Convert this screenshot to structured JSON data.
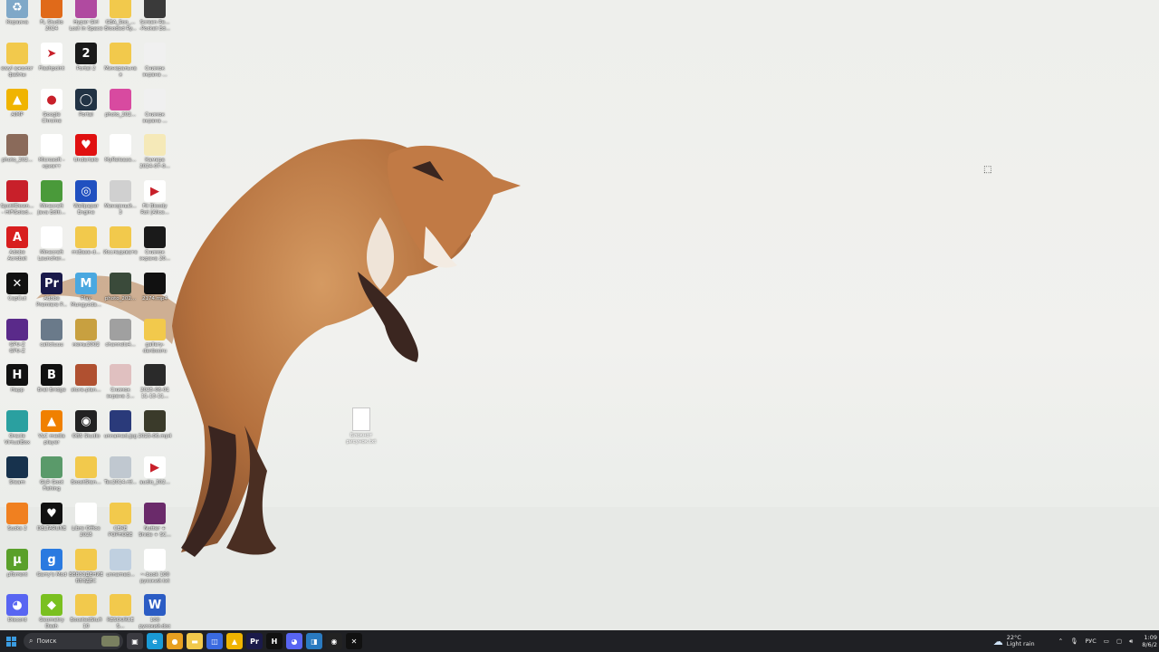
{
  "desktop": {
    "icons": [
      {
        "label": "Корзина",
        "icon": "recycle-bin-icon",
        "color": "#7fa8c8",
        "glyph": "♻"
      },
      {
        "label": "FL Studio\n2024",
        "icon": "fl-studio-icon",
        "color": "#e06a1a",
        "glyph": ""
      },
      {
        "label": "Hyper Girl\nLost In Space",
        "icon": "game-icon",
        "color": "#b04aa0",
        "glyph": ""
      },
      {
        "label": "GBA_Soo_...\nBlooded Ry...",
        "icon": "folder-icon",
        "color": "#f2c94c",
        "glyph": ""
      },
      {
        "label": "Screen Re...\n-Pocket Ed...",
        "icon": "video-file-icon",
        "color": "#3a3a3a",
        "glyph": ""
      },
      {
        "label": "ewyl ажолог\nфайлы",
        "icon": "folder-icon",
        "color": "#f2c94c",
        "glyph": ""
      },
      {
        "label": "Flashpoint",
        "icon": "flashpoint-icon",
        "color": "#ffffff",
        "glyph": "➤"
      },
      {
        "label": "Portal 2",
        "icon": "portal2-icon",
        "color": "#1a1a1a",
        "glyph": "2"
      },
      {
        "label": "Минеральная",
        "icon": "folder-icon",
        "color": "#f2c94c",
        "glyph": ""
      },
      {
        "label": "Снимок\nэкрана ...",
        "icon": "screenshot-file-icon",
        "color": "#f0f0f0",
        "glyph": ""
      },
      {
        "label": "AIMP",
        "icon": "aimp-icon",
        "color": "#f0b400",
        "glyph": "▲"
      },
      {
        "label": "Google\nChrome",
        "icon": "chrome-icon",
        "color": "#ffffff",
        "glyph": "●"
      },
      {
        "label": "Portal",
        "icon": "portal-icon",
        "color": "#223344",
        "glyph": "◯"
      },
      {
        "label": "photo_202...",
        "icon": "image-file-icon",
        "color": "#d84aa0",
        "glyph": ""
      },
      {
        "label": "Снимок\nэкрана ...",
        "icon": "screenshot-file-icon",
        "color": "#f0f0f0",
        "glyph": ""
      },
      {
        "label": "photo_202...",
        "icon": "image-file-icon",
        "color": "#8a6a5a",
        "glyph": ""
      },
      {
        "label": "Microsoft -\nкриатт",
        "icon": "blank-file-icon",
        "color": "#ffffff",
        "glyph": ""
      },
      {
        "label": "Undertale",
        "icon": "undertale-icon",
        "color": "#e01010",
        "glyph": "♥"
      },
      {
        "label": "MyRelease...",
        "icon": "blank-file-icon",
        "color": "#ffffff",
        "glyph": ""
      },
      {
        "label": "Камера\n2024-07-0...",
        "icon": "image-file-icon",
        "color": "#f5e9b8",
        "glyph": ""
      },
      {
        "label": "SpotifDown...\n- HiFiSoled...",
        "icon": "app-icon",
        "color": "#c8202a",
        "glyph": ""
      },
      {
        "label": "Minecraft\nJava Editi...",
        "icon": "minecraft-icon",
        "color": "#4a9a3a",
        "glyph": ""
      },
      {
        "label": "Wallpaper\nEngine",
        "icon": "wallpaper-engine-icon",
        "color": "#2050c0",
        "glyph": "◎"
      },
      {
        "label": "Минорный...\n3",
        "icon": "image-file-icon",
        "color": "#d0d0d0",
        "glyph": ""
      },
      {
        "label": "Fit Bloody\nRot [Alice...",
        "icon": "media-file-icon",
        "color": "#ffffff",
        "glyph": "▶"
      },
      {
        "label": "Adobe\nAcrobat",
        "icon": "acrobat-icon",
        "color": "#d81e1e",
        "glyph": "A"
      },
      {
        "label": "Minecraft\nLauncher...",
        "icon": "blank-file-icon",
        "color": "#ffffff",
        "glyph": ""
      },
      {
        "label": "rrcBase-d...",
        "icon": "folder-icon",
        "color": "#f2c94c",
        "glyph": ""
      },
      {
        "label": "Исследовате",
        "icon": "folder-icon",
        "color": "#f2c94c",
        "glyph": ""
      },
      {
        "label": "Снимок\nэкрана 20...",
        "icon": "screenshot-file-icon",
        "color": "#1a1a1a",
        "glyph": ""
      },
      {
        "label": "CapCut",
        "icon": "capcut-icon",
        "color": "#111111",
        "glyph": "✕"
      },
      {
        "label": "Adobe\nPremiere P...",
        "icon": "premiere-icon",
        "color": "#1a1a4a",
        "glyph": "Pr"
      },
      {
        "label": "Play\nMungyoda...",
        "icon": "play-icon",
        "color": "#4aa8e0",
        "glyph": "M"
      },
      {
        "label": "photo_202...",
        "icon": "image-file-icon",
        "color": "#3a4a3a",
        "glyph": ""
      },
      {
        "label": "2174.mp4",
        "icon": "video-file-icon",
        "color": "#111111",
        "glyph": ""
      },
      {
        "label": "GPU-Z\nGPU-Z",
        "icon": "gpuz-icon",
        "color": "#5a2a8a",
        "glyph": ""
      },
      {
        "label": "catictuuu",
        "icon": "app-icon",
        "color": "#6a7a8a",
        "glyph": ""
      },
      {
        "label": "мемы2002",
        "icon": "folder-icon",
        "color": "#c8a040",
        "glyph": ""
      },
      {
        "label": "channels4...",
        "icon": "image-file-icon",
        "color": "#a0a0a0",
        "glyph": ""
      },
      {
        "label": "gallery-\ndanbooru",
        "icon": "folder-icon",
        "color": "#f2c94c",
        "glyph": ""
      },
      {
        "label": "Happ",
        "icon": "happ-icon",
        "color": "#111111",
        "glyph": "H"
      },
      {
        "label": "Brat Bridge",
        "icon": "app-icon",
        "color": "#111111",
        "glyph": "B"
      },
      {
        "label": "store-plan...",
        "icon": "image-file-icon",
        "color": "#b05030",
        "glyph": ""
      },
      {
        "label": "Снимок\nэкрана 2...",
        "icon": "screenshot-file-icon",
        "color": "#e0c0c0",
        "glyph": ""
      },
      {
        "label": "2025-06-01\n11-13-11...",
        "icon": "video-file-icon",
        "color": "#2a2a2a",
        "glyph": ""
      },
      {
        "label": "Oracle\nVirtualBox",
        "icon": "virtualbox-icon",
        "color": "#2aa0a0",
        "glyph": ""
      },
      {
        "label": "VLC media\nplayer",
        "icon": "vlc-icon",
        "color": "#f08000",
        "glyph": "▲"
      },
      {
        "label": "OBS Studio",
        "icon": "obs-icon",
        "color": "#222222",
        "glyph": "◉"
      },
      {
        "label": "unnamed.jpg",
        "icon": "image-file-icon",
        "color": "#2a3a7a",
        "glyph": ""
      },
      {
        "label": "2025-06.mp4",
        "icon": "video-file-icon",
        "color": "#3a3a2a",
        "glyph": ""
      },
      {
        "label": "Steam",
        "icon": "steam-icon",
        "color": "#17324d",
        "glyph": ""
      },
      {
        "label": "GLR Goot\nFishing",
        "icon": "game-icon",
        "color": "#5a9a6a",
        "glyph": ""
      },
      {
        "label": "BoostStan...",
        "icon": "folder-icon",
        "color": "#f2c94c",
        "glyph": ""
      },
      {
        "label": "Tec2014.rtf...",
        "icon": "document-file-icon",
        "color": "#c0c8d0",
        "glyph": ""
      },
      {
        "label": "audio_202...",
        "icon": "media-file-icon",
        "color": "#ffffff",
        "glyph": "▶"
      },
      {
        "label": "Sucks 2",
        "icon": "app-icon",
        "color": "#f08020",
        "glyph": ""
      },
      {
        "label": "DELTARUNE",
        "icon": "deltarune-icon",
        "color": "#111111",
        "glyph": "♥"
      },
      {
        "label": "Libre Office\n2025",
        "icon": "document-file-icon",
        "color": "#ffffff",
        "glyph": ""
      },
      {
        "label": "СЕКЕ\nРОРНОВЕ",
        "icon": "folder-icon",
        "color": "#f2c94c",
        "glyph": ""
      },
      {
        "label": "Nutter +\nShide + SC...",
        "icon": "video-file-icon",
        "color": "#6a2a6a",
        "glyph": ""
      },
      {
        "label": "µTorrent",
        "icon": "utorrent-icon",
        "color": "#5aa02a",
        "glyph": "µ"
      },
      {
        "label": "Garry's Mod",
        "icon": "gmod-icon",
        "color": "#2a7ae0",
        "glyph": "g"
      },
      {
        "label": "ВВВЗЗДЕНИЕ\nВВЗДЕС",
        "icon": "folder-icon",
        "color": "#f2c94c",
        "glyph": ""
      },
      {
        "label": "unnamed...",
        "icon": "image-file-icon",
        "color": "#c0d0e0",
        "glyph": ""
      },
      {
        "label": "~-book 100\nрусский.txt",
        "icon": "text-file-icon",
        "color": "#ffffff",
        "glyph": ""
      },
      {
        "label": "Discord",
        "icon": "discord-icon",
        "color": "#5865f2",
        "glyph": "◕"
      },
      {
        "label": "Geometry\nDash",
        "icon": "geometry-dash-icon",
        "color": "#7ac020",
        "glyph": "◆"
      },
      {
        "label": "BoostedStufi\n10",
        "icon": "folder-icon",
        "color": "#f2c94c",
        "glyph": ""
      },
      {
        "label": "RESOURCES...",
        "icon": "folder-icon",
        "color": "#f2c94c",
        "glyph": ""
      },
      {
        "label": "100\nрусский.docx",
        "icon": "word-file-icon",
        "color": "#2b5cc4",
        "glyph": "W"
      }
    ],
    "free_file": {
      "label": "Блокнот\nрисунок.txt"
    }
  },
  "taskbar": {
    "search_placeholder": "Поиск",
    "pinned": [
      {
        "name": "task-view-icon",
        "glyph": "▣",
        "color": "#3a3a40"
      },
      {
        "name": "edge-icon",
        "glyph": "e",
        "color": "#1a9ad6"
      },
      {
        "name": "chrome-icon",
        "glyph": "●",
        "color": "#e8a020"
      },
      {
        "name": "file-explorer-icon",
        "glyph": "▬",
        "color": "#f2c94c"
      },
      {
        "name": "microsoft-store-icon",
        "glyph": "◫",
        "color": "#3a6ae0"
      },
      {
        "name": "aimp-icon",
        "glyph": "▲",
        "color": "#f0b400"
      },
      {
        "name": "premiere-icon",
        "glyph": "Pr",
        "color": "#1a1a4a"
      },
      {
        "name": "happ-icon",
        "glyph": "H",
        "color": "#111111"
      },
      {
        "name": "discord-icon",
        "glyph": "◕",
        "color": "#5865f2"
      },
      {
        "name": "task-manager-icon",
        "glyph": "◨",
        "color": "#2a7ac0"
      },
      {
        "name": "obs-icon",
        "glyph": "◉",
        "color": "#222222"
      },
      {
        "name": "capcut-icon",
        "glyph": "✕",
        "color": "#111111"
      }
    ],
    "weather": {
      "temp": "22°C",
      "desc": "Light rain"
    },
    "language": "РУС",
    "time": "1:09",
    "date": "8/6/2"
  }
}
